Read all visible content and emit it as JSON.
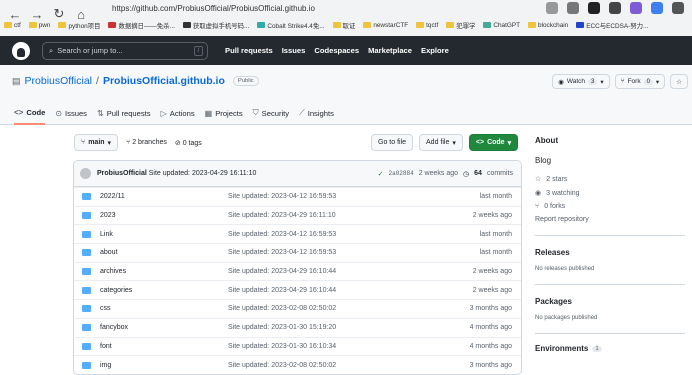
{
  "browser": {
    "url": "https://github.com/ProbiusOfficial/ProbiusOfficial.github.io",
    "bookmarks": [
      "ctf",
      "pwn",
      "python项目",
      "数据摘日——免杀...",
      "获取虚拟手机号码...",
      "Cobalt Strike4.4免...",
      "取证",
      "newstarCTF",
      "tqctf",
      "犯罪学",
      "ChatGPT",
      "blockchain",
      "ECC与ECDSA-努力..."
    ]
  },
  "header": {
    "search_placeholder": "Search or jump to...",
    "slash": "/",
    "nav": [
      "Pull requests",
      "Issues",
      "Codespaces",
      "Marketplace",
      "Explore"
    ]
  },
  "repo": {
    "owner": "ProbiusOfficial",
    "name": "ProbiusOfficial.github.io",
    "visibility": "Public",
    "watch_label": "Watch",
    "watch_count": "3",
    "fork_label": "Fork",
    "fork_count": "0",
    "tabs": [
      "Code",
      "Issues",
      "Pull requests",
      "Actions",
      "Projects",
      "Security",
      "Insights"
    ]
  },
  "toolbar": {
    "branch": "main",
    "branches": "2 branches",
    "tags": "0 tags",
    "goto": "Go to file",
    "add": "Add file",
    "code": "Code"
  },
  "commit": {
    "author": "ProbiusOfficial",
    "message": "Site updated: 2023-04-29 16:11:10",
    "sha": "2a02884",
    "when": "2 weeks ago",
    "count": "64",
    "count_label": "commits"
  },
  "files": [
    {
      "name": "2022/11",
      "msg": "Site updated: 2023-04-12 16:59:53",
      "date": "last month"
    },
    {
      "name": "2023",
      "msg": "Site updated: 2023-04-29 16:11:10",
      "date": "2 weeks ago"
    },
    {
      "name": "Link",
      "msg": "Site updated: 2023-04-12 16:59:53",
      "date": "last month"
    },
    {
      "name": "about",
      "msg": "Site updated: 2023-04-12 16:59:53",
      "date": "last month"
    },
    {
      "name": "archives",
      "msg": "Site updated: 2023-04-29 16:10:44",
      "date": "2 weeks ago"
    },
    {
      "name": "categories",
      "msg": "Site updated: 2023-04-29 16:10:44",
      "date": "2 weeks ago"
    },
    {
      "name": "css",
      "msg": "Site updated: 2023-02-08 02:50:02",
      "date": "3 months ago"
    },
    {
      "name": "fancybox",
      "msg": "Site updated: 2023-01-30 15:19:20",
      "date": "4 months ago"
    },
    {
      "name": "font",
      "msg": "Site updated: 2023-01-30 16:10:34",
      "date": "4 months ago"
    },
    {
      "name": "img",
      "msg": "Site updated: 2023-02-08 02:50:02",
      "date": "3 months ago"
    }
  ],
  "sidebar": {
    "about": "About",
    "desc": "Blog",
    "stars": "2 stars",
    "watching": "3 watching",
    "forks": "0 forks",
    "report": "Report repository",
    "releases": "Releases",
    "no_releases": "No releases published",
    "packages": "Packages",
    "no_packages": "No packages published",
    "environments": "Environments",
    "env_count": "1"
  }
}
